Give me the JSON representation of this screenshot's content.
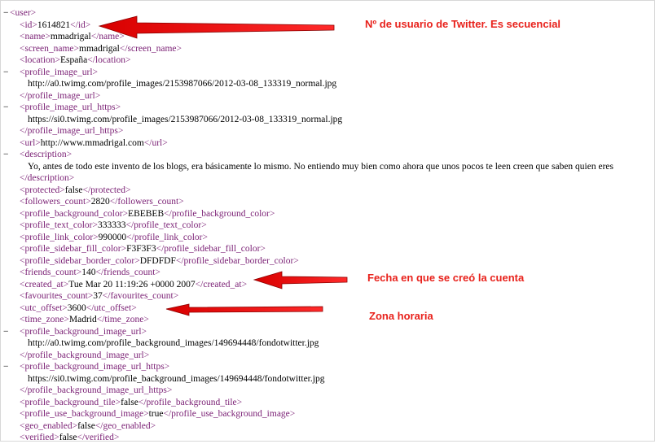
{
  "lines": [
    {
      "toggle": "−",
      "tag": "<user>",
      "text": "",
      "endtag": ""
    },
    {
      "toggle": "",
      "tag": "<id>",
      "text": "1614821",
      "endtag": "</id>"
    },
    {
      "toggle": "",
      "tag": "<name>",
      "text": "mmadrigal",
      "endtag": "</name>"
    },
    {
      "toggle": "",
      "tag": "<screen_name>",
      "text": "mmadrigal",
      "endtag": "</screen_name>"
    },
    {
      "toggle": "",
      "tag": "<location>",
      "text": "España",
      "endtag": "</location>"
    },
    {
      "toggle": "−",
      "tag": "<profile_image_url>",
      "text": "",
      "endtag": ""
    },
    {
      "toggle": "",
      "tag": "",
      "text": "http://a0.twimg.com/profile_images/2153987066/2012-03-08_133319_normal.jpg",
      "endtag": ""
    },
    {
      "toggle": "",
      "tag": "",
      "text": "",
      "endtag": "</profile_image_url>"
    },
    {
      "toggle": "−",
      "tag": "<profile_image_url_https>",
      "text": "",
      "endtag": ""
    },
    {
      "toggle": "",
      "tag": "",
      "text": "https://si0.twimg.com/profile_images/2153987066/2012-03-08_133319_normal.jpg",
      "endtag": ""
    },
    {
      "toggle": "",
      "tag": "",
      "text": "",
      "endtag": "</profile_image_url_https>"
    },
    {
      "toggle": "",
      "tag": "<url>",
      "text": "http://www.mmadrigal.com",
      "endtag": "</url>"
    },
    {
      "toggle": "−",
      "tag": "<description>",
      "text": "",
      "endtag": ""
    },
    {
      "toggle": "",
      "tag": "",
      "text": "Yo, antes de todo este invento de los blogs, era básicamente lo mismo. No entiendo muy bien como ahora que unos pocos te leen creen que saben quien eres",
      "endtag": ""
    },
    {
      "toggle": "",
      "tag": "",
      "text": "",
      "endtag": "</description>"
    },
    {
      "toggle": "",
      "tag": "<protected>",
      "text": "false",
      "endtag": "</protected>"
    },
    {
      "toggle": "",
      "tag": "<followers_count>",
      "text": "2820",
      "endtag": "</followers_count>"
    },
    {
      "toggle": "",
      "tag": "<profile_background_color>",
      "text": "EBEBEB",
      "endtag": "</profile_background_color>"
    },
    {
      "toggle": "",
      "tag": "<profile_text_color>",
      "text": "333333",
      "endtag": "</profile_text_color>"
    },
    {
      "toggle": "",
      "tag": "<profile_link_color>",
      "text": "990000",
      "endtag": "</profile_link_color>"
    },
    {
      "toggle": "",
      "tag": "<profile_sidebar_fill_color>",
      "text": "F3F3F3",
      "endtag": "</profile_sidebar_fill_color>"
    },
    {
      "toggle": "",
      "tag": "<profile_sidebar_border_color>",
      "text": "DFDFDF",
      "endtag": "</profile_sidebar_border_color>"
    },
    {
      "toggle": "",
      "tag": "<friends_count>",
      "text": "140",
      "endtag": "</friends_count>"
    },
    {
      "toggle": "",
      "tag": "<created_at>",
      "text": "Tue Mar 20 11:19:26 +0000 2007",
      "endtag": "</created_at>"
    },
    {
      "toggle": "",
      "tag": "<favourites_count>",
      "text": "37",
      "endtag": "</favourites_count>"
    },
    {
      "toggle": "",
      "tag": "<utc_offset>",
      "text": "3600",
      "endtag": "</utc_offset>"
    },
    {
      "toggle": "",
      "tag": "<time_zone>",
      "text": "Madrid",
      "endtag": "</time_zone>"
    },
    {
      "toggle": "−",
      "tag": "<profile_background_image_url>",
      "text": "",
      "endtag": ""
    },
    {
      "toggle": "",
      "tag": "",
      "text": "http://a0.twimg.com/profile_background_images/149694448/fondotwitter.jpg",
      "endtag": ""
    },
    {
      "toggle": "",
      "tag": "",
      "text": "",
      "endtag": "</profile_background_image_url>"
    },
    {
      "toggle": "−",
      "tag": "<profile_background_image_url_https>",
      "text": "",
      "endtag": ""
    },
    {
      "toggle": "",
      "tag": "",
      "text": "https://si0.twimg.com/profile_background_images/149694448/fondotwitter.jpg",
      "endtag": ""
    },
    {
      "toggle": "",
      "tag": "",
      "text": "",
      "endtag": "</profile_background_image_url_https>"
    },
    {
      "toggle": "",
      "tag": "<profile_background_tile>",
      "text": "false",
      "endtag": "</profile_background_tile>"
    },
    {
      "toggle": "",
      "tag": "<profile_use_background_image>",
      "text": "true",
      "endtag": "</profile_use_background_image>"
    },
    {
      "toggle": "",
      "tag": "<geo_enabled>",
      "text": "false",
      "endtag": "</geo_enabled>"
    },
    {
      "toggle": "",
      "tag": "<verified>",
      "text": "false",
      "endtag": "</verified>"
    }
  ],
  "annotations": {
    "id_note": "Nº de usuario de Twitter. Es secuencial",
    "created_note": "Fecha en que se creó la cuenta",
    "timezone_note": "Zona horaria"
  },
  "colors": {
    "tag": "#7a1f74",
    "annotation": "#e8211b"
  }
}
